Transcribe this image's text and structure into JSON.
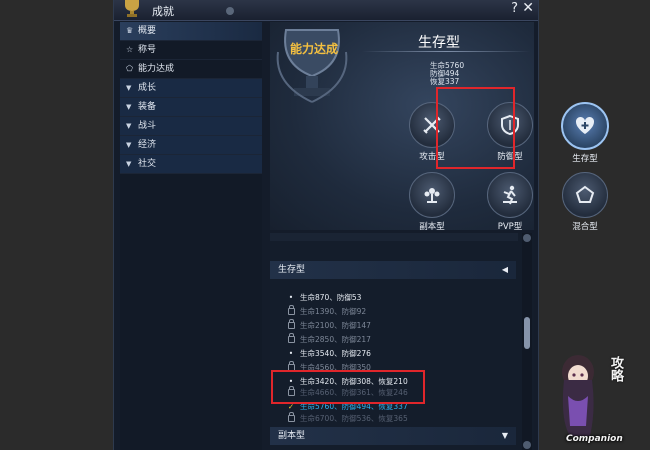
{
  "window": {
    "title": "成就"
  },
  "sidebar": {
    "items": [
      {
        "label": "概要",
        "icon": "trophy-icon"
      },
      {
        "label": "称号",
        "icon": "star-icon"
      },
      {
        "label": "能力达成",
        "icon": "pentagon-icon"
      }
    ],
    "categories": [
      {
        "label": "成长"
      },
      {
        "label": "装备"
      },
      {
        "label": "战斗"
      },
      {
        "label": "经济"
      },
      {
        "label": "社交"
      }
    ]
  },
  "hero": {
    "label": "能力达成",
    "title": "生存型",
    "stats": [
      "生命5760",
      "防御494",
      "恢复337"
    ]
  },
  "types": [
    {
      "label": "攻击型",
      "icon": "swords-icon"
    },
    {
      "label": "防御型",
      "icon": "shield-icon"
    },
    {
      "label": "生存型",
      "icon": "heart-plus-icon",
      "selected": true
    },
    {
      "label": "副本型",
      "icon": "tree-icon"
    },
    {
      "label": "PVP型",
      "icon": "pvp-figure-icon"
    },
    {
      "label": "混合型",
      "icon": "pentagon-icon"
    }
  ],
  "list": {
    "section": "生存型",
    "rows": [
      {
        "text": "生命870、防御53",
        "status": "done"
      },
      {
        "text": "生命1390、防御92",
        "status": "locked"
      },
      {
        "text": "生命2100、防御147",
        "status": "locked"
      },
      {
        "text": "生命2850、防御217",
        "status": "locked"
      },
      {
        "text": "生命3540、防御276",
        "status": "done"
      },
      {
        "text": "生命4560、防御350",
        "status": "locked"
      },
      {
        "text": "生命3420、防御308、恢复210",
        "status": "done"
      },
      {
        "text": "生命4660、防御361、恢复246",
        "status": "faded"
      },
      {
        "text": "生命5760、防御494、恢复337",
        "status": "current"
      },
      {
        "text": "生命6700、防御536、恢复365",
        "status": "faded"
      }
    ],
    "next_section": "副本型"
  },
  "watermark": {
    "text": "Companion",
    "side": "攻略"
  },
  "colors": {
    "accent_gold": "#f4c040",
    "highlight_red": "#e0262b",
    "current_cyan": "#2fb2ee"
  }
}
